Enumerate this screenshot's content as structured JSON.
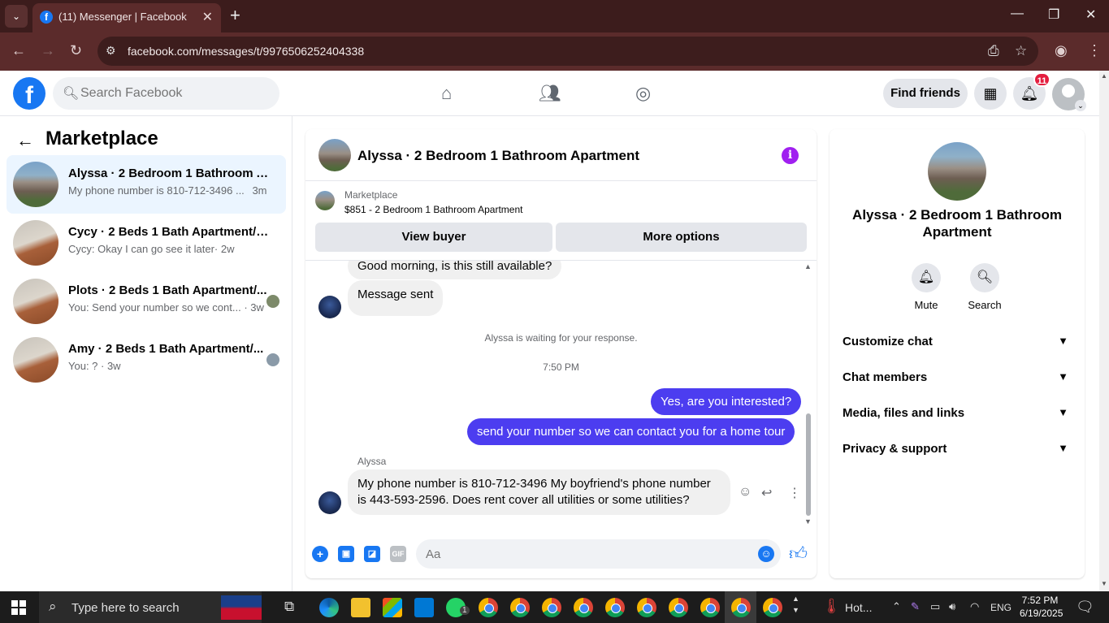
{
  "browser": {
    "tab_title": "(11) Messenger | Facebook",
    "favicon": "f",
    "url": "facebook.com/messages/t/9976506252404338"
  },
  "fb": {
    "logo": "f",
    "search_placeholder": "Search Facebook",
    "find_friends": "Find friends",
    "notif_count": "11"
  },
  "left": {
    "title": "Marketplace",
    "conversations": [
      {
        "name": "Alyssa · 2 Bedroom 1 Bathroom Ap...",
        "snippet": "My phone number is 810-712-3496 ...",
        "time": "3m"
      },
      {
        "name": "Cycy · 2 Beds 1 Bath Apartment/co...",
        "snippet": "Cycy: Okay I can go see it later",
        "time": "· 2w"
      },
      {
        "name": "Plots · 2 Beds 1 Bath Apartment/...",
        "snippet": "You: Send your number so we cont... ",
        "time": "· 3w"
      },
      {
        "name": "Amy · 2 Beds 1 Bath Apartment/...",
        "snippet": "You: ? ",
        "time": "· 3w"
      }
    ]
  },
  "chat": {
    "header_name": "Alyssa · 2 Bedroom 1 Bathroom Apartment",
    "info_glyph": "i",
    "marketplace_label": "Marketplace",
    "listing": "$851 - 2 Bedroom 1 Bathroom Apartment",
    "view_buyer": "View buyer",
    "more_options": "More options",
    "messages": {
      "m1": "Good morning, is this still available?",
      "m2": "Message sent",
      "waiting": "Alyssa is waiting for your response.",
      "timestamp": "7:50 PM",
      "out1": "Yes, are you interested?",
      "out2": "send your number so we can contact you for a home tour",
      "sender": "Alyssa",
      "m3": "My phone number is 810-712-3496 My boyfriend's phone number is 443-593-2596. Does rent cover all utilities or some utilities?"
    },
    "composer_placeholder": "Aa",
    "gif_label": "GIF"
  },
  "right": {
    "name": "Alyssa · 2 Bedroom 1 Bathroom Apartment",
    "mute": "Mute",
    "search": "Search",
    "rows": [
      "Customize chat",
      "Chat members",
      "Media, files and links",
      "Privacy & support"
    ]
  },
  "taskbar": {
    "search_text": "Type here to search",
    "weather": "Hot...",
    "lang": "ENG",
    "time": "7:52 PM",
    "date": "6/19/2025",
    "whatsapp_badge": "1"
  },
  "colors": {
    "fb_blue": "#1877f2",
    "outgoing_bubble": "#4c3df0",
    "info_purple": "#a020f0",
    "browser_frame": "#5b2b2b"
  }
}
